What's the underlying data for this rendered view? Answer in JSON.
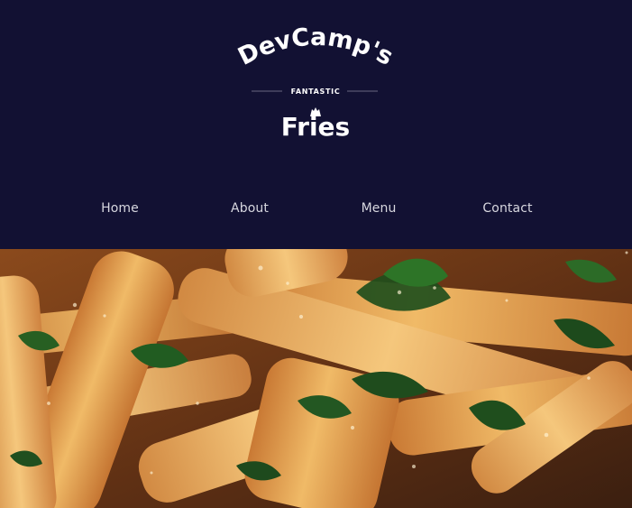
{
  "brand": {
    "logo_line1": "DevCamp's",
    "logo_tagline": "FANTASTIC",
    "logo_line2": "Fries"
  },
  "nav": {
    "items": [
      "Home",
      "About",
      "Menu",
      "Contact"
    ]
  },
  "colors": {
    "header_bg": "#121133",
    "nav_text": "#d7d7df",
    "fries": "#e7a753",
    "parsley": "#245b22"
  },
  "icons": {
    "logo_fry_icon": "fries-icon"
  }
}
